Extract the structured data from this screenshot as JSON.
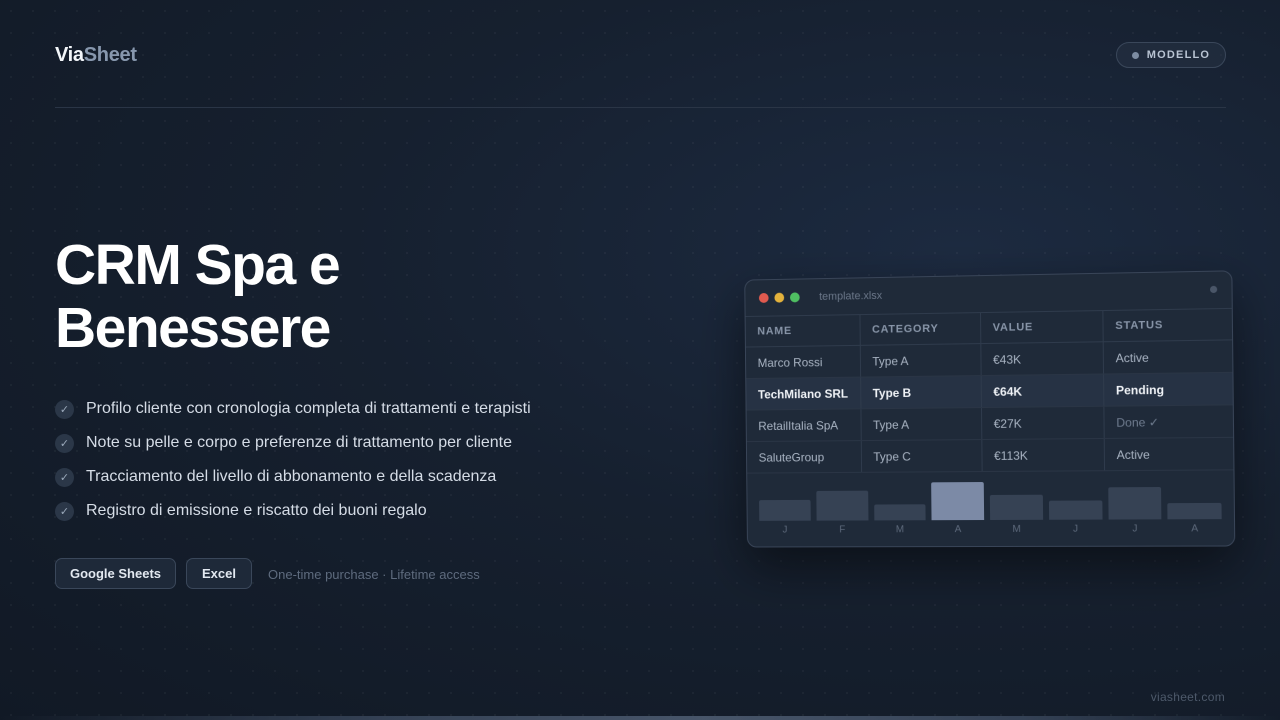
{
  "logo": {
    "part1": "Via",
    "part2": "Sheet"
  },
  "badge": {
    "label": "MODELLO"
  },
  "title": "CRM Spa e Benessere",
  "features": [
    "Profilo cliente con cronologia completa di trattamenti e terapisti",
    "Note su pelle e corpo e preferenze di trattamento per cliente",
    "Tracciamento del livello di abbonamento e della scadenza",
    "Registro di emissione e riscatto dei buoni regalo"
  ],
  "formats": {
    "google_sheets": "Google Sheets",
    "excel": "Excel"
  },
  "purchase_note": "One-time purchase · Lifetime access",
  "footer": "viasheet.com",
  "colors": {
    "background": "#141d2b",
    "accent": "#7c8aa6"
  },
  "window": {
    "filename": "template.xlsx",
    "lights": [
      "#e05a4f",
      "#e3b23c",
      "#4fbf62"
    ],
    "headers": {
      "name": "NAME",
      "category": "CATEGORY",
      "value": "VALUE",
      "status": "STATUS"
    },
    "rows": [
      {
        "name": "Marco Rossi",
        "category": "Type A",
        "value": "€43K",
        "status": "Active"
      },
      {
        "name": "TechMilano SRL",
        "category": "Type B",
        "value": "€64K",
        "status": "Pending"
      },
      {
        "name": "RetailItalia SpA",
        "category": "Type A",
        "value": "€27K",
        "status": "Done ✓"
      },
      {
        "name": "SaluteGroup",
        "category": "Type C",
        "value": "€113K",
        "status": "Active"
      }
    ],
    "highlighted_row": 1,
    "chart": {
      "months": [
        "J",
        "F",
        "M",
        "A",
        "M",
        "J",
        "J",
        "A"
      ],
      "levels": [
        0.55,
        0.78,
        0.42,
        1.0,
        0.65,
        0.5,
        0.85,
        0.42
      ],
      "highlight_index": 3
    }
  }
}
